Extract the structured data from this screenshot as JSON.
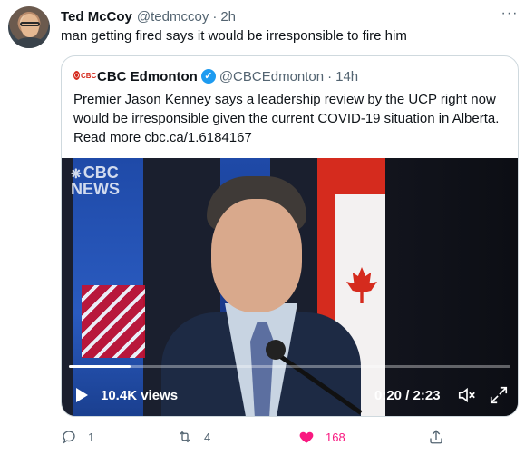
{
  "tweet": {
    "author_name": "Ted McCoy",
    "author_handle": "@tedmccoy",
    "separator": "·",
    "time": "2h",
    "text": "man getting fired says it would be irresponsible to fire him",
    "more_label": "···"
  },
  "quote": {
    "logo_text": "CBC",
    "author_name": "CBC Edmonton",
    "verified_mark": "✓",
    "author_handle": "@CBCEdmonton",
    "separator": "·",
    "time": "14h",
    "lines": [
      "Premier Jason Kenney says a leadership review by the UCP right now",
      "would be irresponsible given the current COVID-19 situation in Alberta.",
      "Read more cbc.ca/1.6184167"
    ]
  },
  "video": {
    "watermark_line1": "CBC",
    "watermark_line2": "NEWS",
    "views": "10.4K views",
    "time": "0:20 / 2:23",
    "progress_fraction": 0.14
  },
  "actions": {
    "reply_count": "1",
    "retweet_count": "4",
    "like_count": "168",
    "like_color": "#f91880"
  },
  "icons": [
    "more-icon",
    "verified-icon",
    "play-icon",
    "mute-icon",
    "fullscreen-icon",
    "reply-icon",
    "retweet-icon",
    "like-icon",
    "share-icon"
  ]
}
